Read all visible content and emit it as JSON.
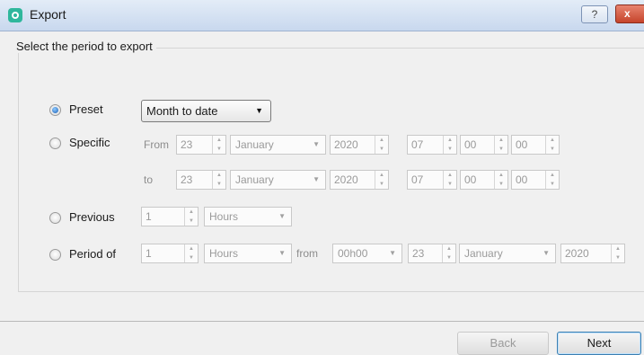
{
  "window": {
    "title": "Export",
    "help_label": "?",
    "close_label": "x"
  },
  "dialog": {
    "group_title": "Select the period to export",
    "preset": {
      "label": "Preset",
      "checked": true,
      "value": "Month to date"
    },
    "specific": {
      "label": "Specific",
      "checked": false,
      "from_label": "From",
      "to_label": "to",
      "from": {
        "day": "23",
        "month": "January",
        "year": "2020",
        "hour": "07",
        "minute": "00",
        "second": "00"
      },
      "to": {
        "day": "23",
        "month": "January",
        "year": "2020",
        "hour": "07",
        "minute": "00",
        "second": "00"
      }
    },
    "previous": {
      "label": "Previous",
      "checked": false,
      "count": "1",
      "unit": "Hours"
    },
    "period_of": {
      "label": "Period of",
      "checked": false,
      "count": "1",
      "unit": "Hours",
      "from_label": "from",
      "time": "00h00",
      "day": "23",
      "month": "January",
      "year": "2020"
    }
  },
  "buttons": {
    "back": "Back",
    "next": "Next"
  }
}
